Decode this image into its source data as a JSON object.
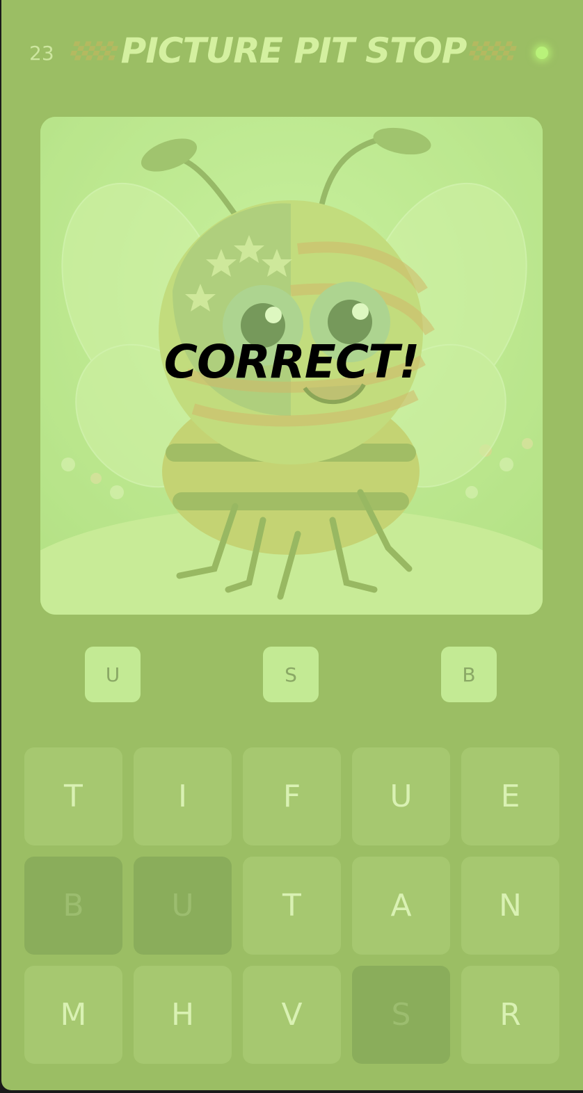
{
  "header": {
    "level": "23",
    "title": "PICTURE PIT STOP"
  },
  "picture": {
    "subject": "cartoon bee with american flag pattern",
    "overlay_text": "CORRECT!"
  },
  "answer": {
    "slots": [
      "U",
      "S",
      "B"
    ]
  },
  "keyboard": {
    "keys": [
      {
        "letter": "T",
        "used": false
      },
      {
        "letter": "I",
        "used": false
      },
      {
        "letter": "F",
        "used": false
      },
      {
        "letter": "U",
        "used": false
      },
      {
        "letter": "E",
        "used": false
      },
      {
        "letter": "B",
        "used": true
      },
      {
        "letter": "U",
        "used": true
      },
      {
        "letter": "T",
        "used": false
      },
      {
        "letter": "A",
        "used": false
      },
      {
        "letter": "N",
        "used": false
      },
      {
        "letter": "M",
        "used": false
      },
      {
        "letter": "H",
        "used": false
      },
      {
        "letter": "V",
        "used": false
      },
      {
        "letter": "S",
        "used": true
      },
      {
        "letter": "R",
        "used": false
      }
    ]
  },
  "colors": {
    "background": "#9bbe64",
    "tile": "#a6c870",
    "tile_used": "#8aad5b",
    "slot": "#c3ea94",
    "status_dot": "#b9f27a"
  }
}
